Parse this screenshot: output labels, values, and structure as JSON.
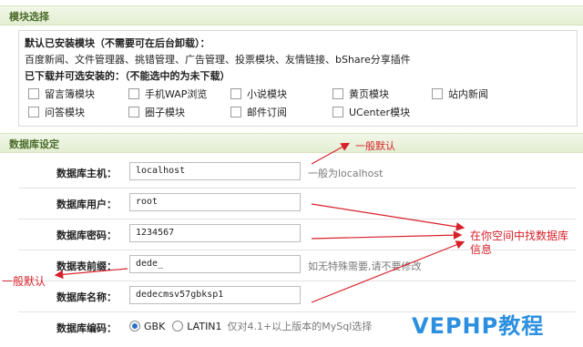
{
  "module_section": {
    "title": "模块选择",
    "installed_heading": "默认已安装模块（不需要可在后台卸载）：",
    "installed_list": "百度新闻、文件管理器、挑错管理、广告管理、投票模块、友情链接、bShare分享插件",
    "optional_heading": "已下载并可选安装的：（不能选中的为未下载）",
    "optional_modules": [
      "留言簿模块",
      "手机WAP浏览",
      "小说模块",
      "黄页模块",
      "站内新闻",
      "问答模块",
      "圈子模块",
      "邮件订阅",
      "UCenter模块"
    ]
  },
  "db_section": {
    "title": "数据库设定",
    "host": {
      "label": "数据库主机：",
      "value": "localhost",
      "hint": "一般为localhost"
    },
    "user": {
      "label": "数据库用户：",
      "value": "root"
    },
    "password": {
      "label": "数据库密码：",
      "value": "1234567"
    },
    "prefix": {
      "label": "数据表前缀：",
      "value": "dede_",
      "hint": "如无特殊需要,请不要修改"
    },
    "name": {
      "label": "数据库名称：",
      "value": "dedecmsv57gbksp1"
    },
    "charset": {
      "label": "数据库编码：",
      "options": [
        "GBK",
        "LATIN1"
      ],
      "selected": "GBK",
      "hint": "仅对4.1+以上版本的MySql选择"
    }
  },
  "annotations": {
    "default_note_top": "一般默认",
    "space_note_line1": "在你空间中找数据库",
    "space_note_line2": "信息",
    "default_note_left": "一般默认",
    "arrow_color": "#d8202a"
  },
  "watermark": "VEPHP教程"
}
